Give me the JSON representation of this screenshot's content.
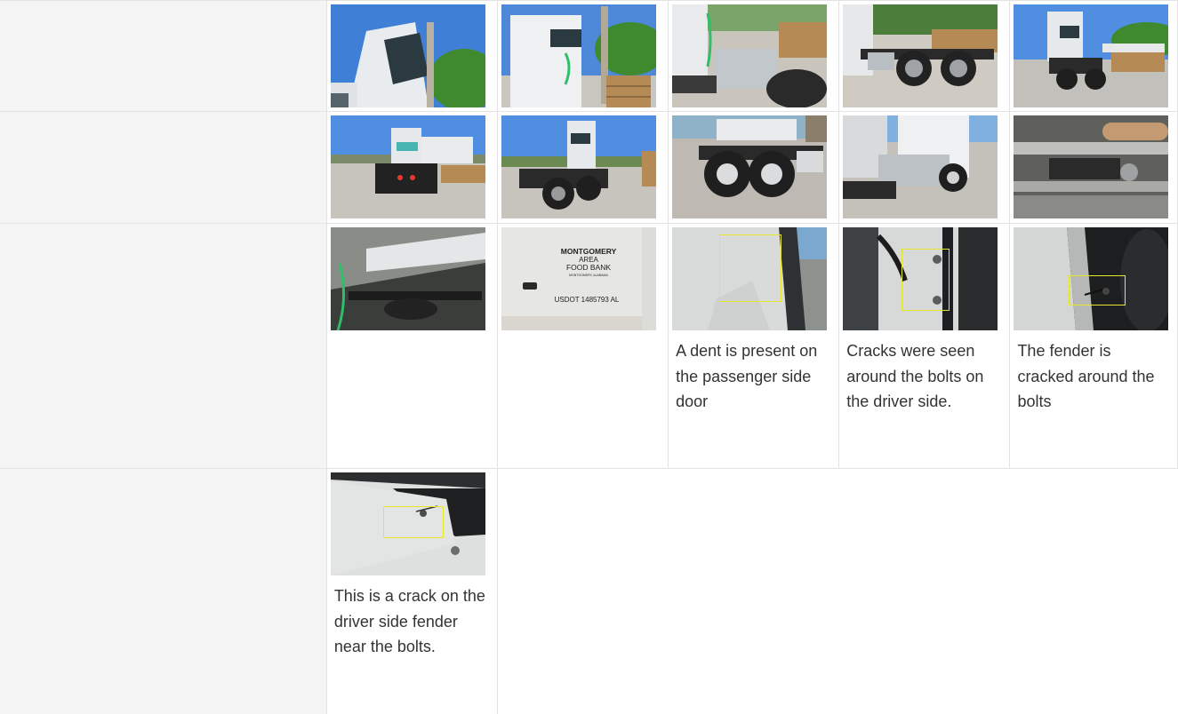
{
  "rows": [
    {
      "photos": [
        {
          "name": "truck-cab-front-left"
        },
        {
          "name": "truck-cab-left-side"
        },
        {
          "name": "truck-fuel-tank-rear"
        },
        {
          "name": "truck-rear-wheels-side"
        },
        {
          "name": "truck-rear-quarter"
        }
      ]
    },
    {
      "photos": [
        {
          "name": "truck-rear-view"
        },
        {
          "name": "truck-rear-left-quarter"
        },
        {
          "name": "truck-tandem-wheels"
        },
        {
          "name": "truck-right-side-tank"
        },
        {
          "name": "truck-undercarriage"
        }
      ]
    },
    {
      "photos": [
        {
          "name": "truck-under-cab"
        },
        {
          "name": "truck-door-lettering",
          "door_text": [
            "MONTGOMERY",
            "AREA",
            "FOOD BANK",
            "MONTGOMERY, ALABAMA",
            "USDOT 1485793 AL"
          ]
        },
        {
          "name": "dent-passenger-door",
          "caption": "A dent is present on the passenger side door"
        },
        {
          "name": "cracks-driver-bolts",
          "caption": "Cracks were seen around the bolts on the driver side."
        },
        {
          "name": "fender-cracked-bolts",
          "caption": "The fender is cracked around the bolts"
        }
      ]
    },
    {
      "photos": [
        {
          "name": "crack-driver-fender",
          "caption": "This is a crack on the driver side fender near the bolts."
        }
      ]
    }
  ],
  "colors": {
    "label_cell_bg": "#f5f5f5",
    "grid_border": "#e3e3e3",
    "caption_text": "#333333",
    "highlight": "#e6e62a",
    "sky": "#3f7fd6"
  }
}
